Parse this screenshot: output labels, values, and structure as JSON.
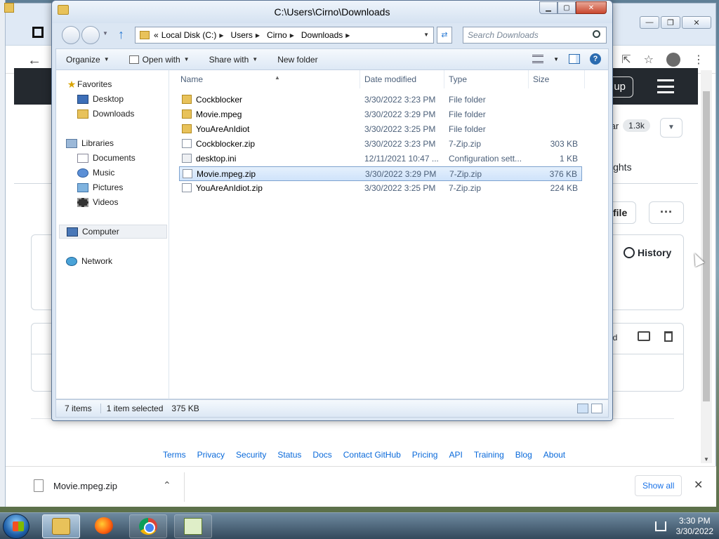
{
  "explorer": {
    "title": "C:\\Users\\Cirno\\Downloads",
    "breadcrumb_prefix": "«",
    "breadcrumb": [
      "Local Disk (C:)",
      "Users",
      "Cirno",
      "Downloads"
    ],
    "search_placeholder": "Search Downloads",
    "commands": {
      "organize": "Organize",
      "open_with": "Open with",
      "share_with": "Share with",
      "new_folder": "New folder"
    },
    "nav": {
      "favorites": "Favorites",
      "desktop": "Desktop",
      "downloads": "Downloads",
      "libraries": "Libraries",
      "documents": "Documents",
      "music": "Music",
      "pictures": "Pictures",
      "videos": "Videos",
      "computer": "Computer",
      "network": "Network"
    },
    "columns": {
      "name": "Name",
      "date": "Date modified",
      "type": "Type",
      "size": "Size"
    },
    "files": [
      {
        "name": "Cockblocker",
        "date": "3/30/2022 3:23 PM",
        "type": "File folder",
        "size": "",
        "icon": "folder-icon"
      },
      {
        "name": "Movie.mpeg",
        "date": "3/30/2022 3:29 PM",
        "type": "File folder",
        "size": "",
        "icon": "folder-icon"
      },
      {
        "name": "YouAreAnIdiot",
        "date": "3/30/2022 3:25 PM",
        "type": "File folder",
        "size": "",
        "icon": "folder-icon"
      },
      {
        "name": "Cockblocker.zip",
        "date": "3/30/2022 3:23 PM",
        "type": "7-Zip.zip",
        "size": "303 KB",
        "icon": "file-icon"
      },
      {
        "name": "desktop.ini",
        "date": "12/11/2021 10:47 ...",
        "type": "Configuration sett...",
        "size": "1 KB",
        "icon": "settings-file-icon"
      },
      {
        "name": "Movie.mpeg.zip",
        "date": "3/30/2022 3:29 PM",
        "type": "7-Zip.zip",
        "size": "376 KB",
        "icon": "file-icon"
      },
      {
        "name": "YouAreAnIdiot.zip",
        "date": "3/30/2022 3:25 PM",
        "type": "7-Zip.zip",
        "size": "224 KB",
        "icon": "file-icon"
      }
    ],
    "selected_index": 5,
    "status": {
      "count": "7 items",
      "selected": "1 item selected",
      "size": "375 KB"
    }
  },
  "browser": {
    "signup": "up",
    "star_label": "tar",
    "star_count": "1.3k",
    "insights": "ights",
    "add_file": "file",
    "more": "···",
    "history": "History",
    "raw_label": "ad",
    "footer_links": [
      "Terms",
      "Privacy",
      "Security",
      "Status",
      "Docs",
      "Contact GitHub",
      "Pricing",
      "API",
      "Training",
      "Blog",
      "About"
    ]
  },
  "download_bar": {
    "file": "Movie.mpeg.zip",
    "show_all": "Show all"
  },
  "taskbar": {
    "time": "3:30 PM",
    "date": "3/30/2022"
  },
  "colors": {
    "selection_bg": "#cfe3fb",
    "link": "#0969da",
    "gh_header": "#24292f"
  }
}
